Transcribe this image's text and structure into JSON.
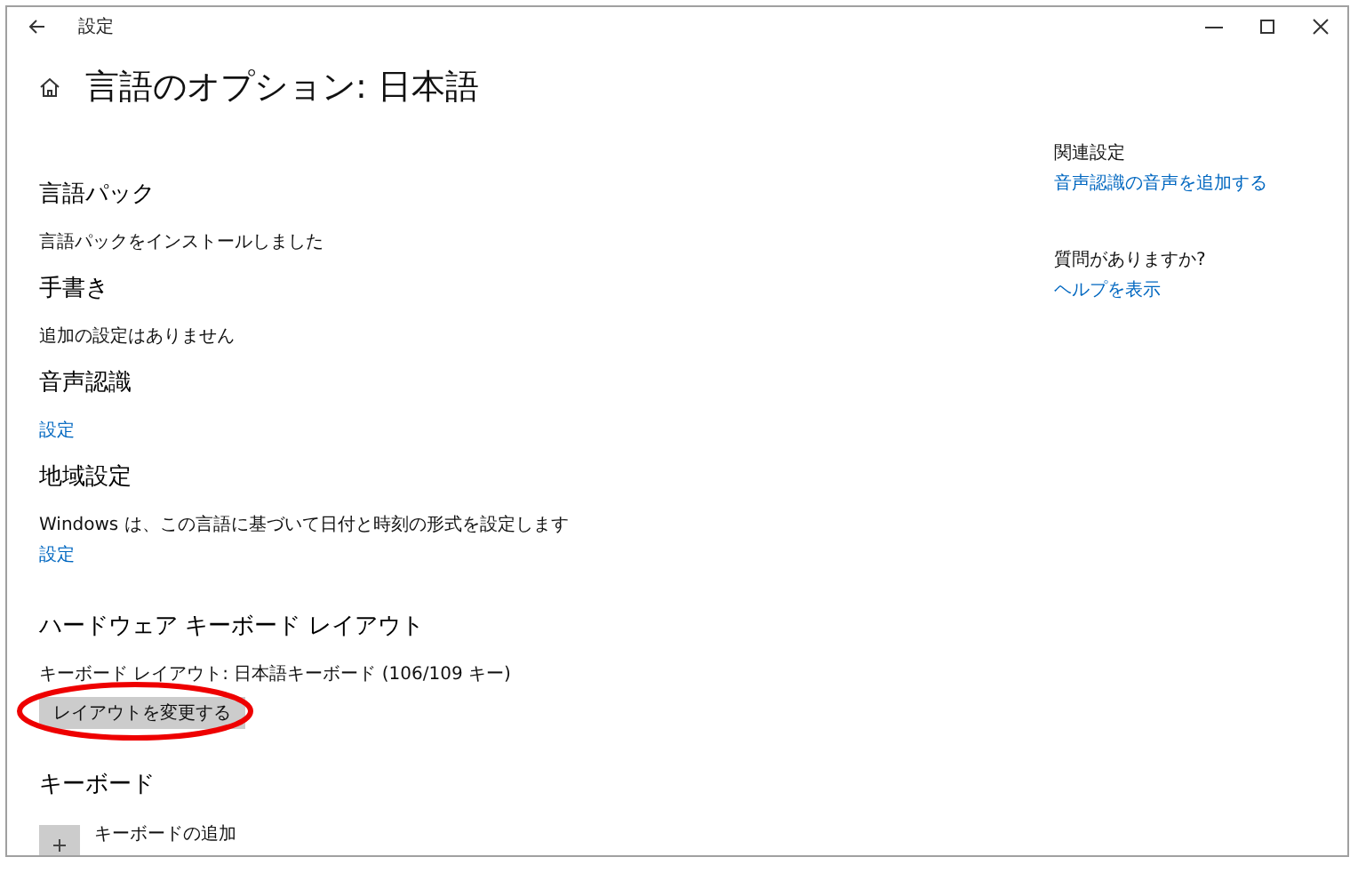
{
  "window": {
    "title": "設定"
  },
  "page_title": "言語のオプション: 日本語",
  "sections": [
    {
      "heading": "言語パック",
      "items": [
        {
          "kind": "text",
          "text": "言語パックをインストールしました"
        }
      ]
    },
    {
      "heading": "手書き",
      "items": [
        {
          "kind": "text",
          "text": "追加の設定はありません"
        }
      ]
    },
    {
      "heading": "音声認識",
      "items": [
        {
          "kind": "link",
          "text": "設定"
        }
      ]
    },
    {
      "heading": "地域設定",
      "items": [
        {
          "kind": "text",
          "text": "Windows は、この言語に基づいて日付と時刻の形式を設定します"
        },
        {
          "kind": "link",
          "text": "設定"
        }
      ]
    },
    {
      "heading": "ハードウェア キーボード レイアウト",
      "items": [
        {
          "kind": "text",
          "text": "キーボード レイアウト: 日本語キーボード (106/109 キー)"
        },
        {
          "kind": "button",
          "text": "レイアウトを変更する",
          "highlighted": true
        }
      ]
    },
    {
      "heading": "キーボード",
      "items": [
        {
          "kind": "add",
          "text": "キーボードの追加"
        }
      ]
    }
  ],
  "related": [
    {
      "heading": "関連設定",
      "link": "音声認識の音声を追加する"
    },
    {
      "heading": "質問がありますか?",
      "link": "ヘルプを表示"
    }
  ]
}
